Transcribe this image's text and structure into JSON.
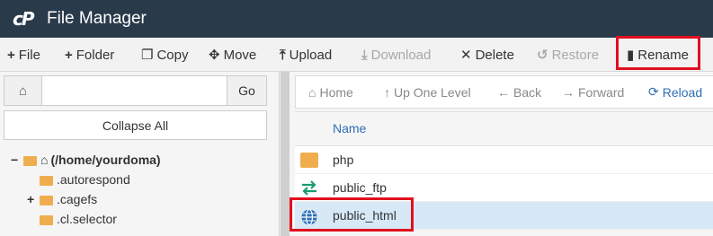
{
  "app": {
    "logo": "cP",
    "title": "File Manager"
  },
  "toolbar": {
    "file": "File",
    "folder": "Folder",
    "copy": "Copy",
    "move": "Move",
    "upload": "Upload",
    "download": "Download",
    "delete": "Delete",
    "restore": "Restore",
    "rename": "Rename"
  },
  "left_panel": {
    "go_label": "Go",
    "search_value": "",
    "collapse_label": "Collapse All",
    "tree": {
      "root": "(/home/yourdoma)",
      "items": [
        ".autorespond",
        ".cagefs",
        ".cl.selector"
      ]
    }
  },
  "nav": {
    "home": "Home",
    "up": "Up One Level",
    "back": "Back",
    "forward": "Forward",
    "reload": "Reload"
  },
  "table": {
    "column_name": "Name",
    "rows": [
      {
        "name": "php",
        "icon": "folder-icon"
      },
      {
        "name": "public_ftp",
        "icon": "transfer-arrows-icon"
      },
      {
        "name": "public_html",
        "icon": "globe-icon",
        "selected": true
      }
    ]
  },
  "colors": {
    "header_bg": "#293a4a",
    "accent": "#2d6fb5",
    "folder": "#f0ad4e",
    "highlight": "#e0101f",
    "selected_row": "#d7e9f7"
  }
}
